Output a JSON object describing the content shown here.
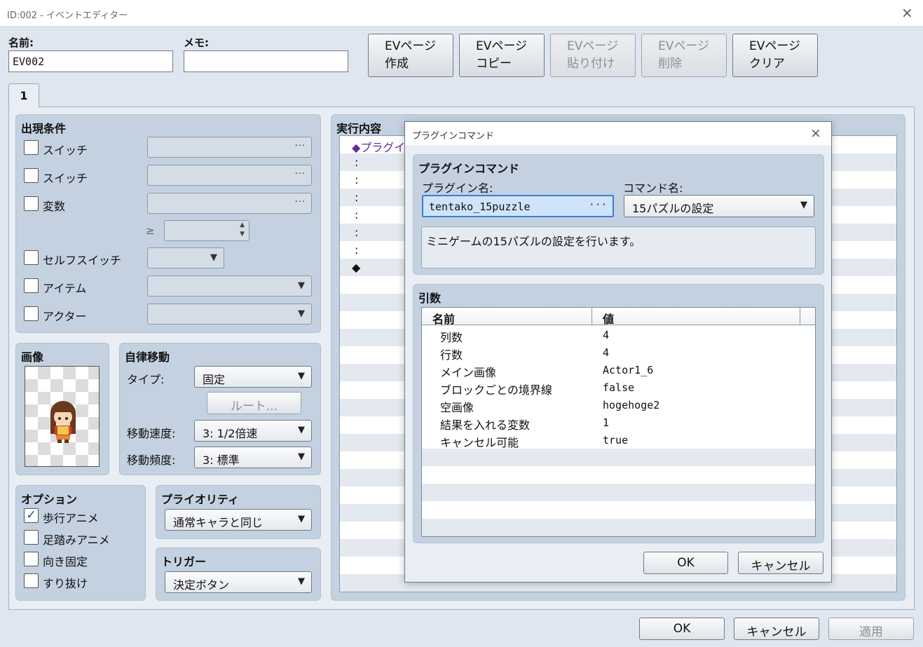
{
  "window": {
    "title": "ID:002 - イベントエディター"
  },
  "header": {
    "name_label": "名前:",
    "name_value": "EV002",
    "memo_label": "メモ:",
    "memo_value": "",
    "ev_buttons": [
      {
        "line1": "EVページ",
        "line2": "作成",
        "enabled": true
      },
      {
        "line1": "EVページ",
        "line2": "コピー",
        "enabled": true
      },
      {
        "line1": "EVページ",
        "line2": "貼り付け",
        "enabled": false
      },
      {
        "line1": "EVページ",
        "line2": "削除",
        "enabled": false
      },
      {
        "line1": "EVページ",
        "line2": "クリア",
        "enabled": true
      }
    ]
  },
  "tabs": [
    "1"
  ],
  "conditions": {
    "title": "出現条件",
    "items": [
      {
        "label": "スイッチ",
        "checked": false
      },
      {
        "label": "スイッチ",
        "checked": false
      },
      {
        "label": "変数",
        "checked": false
      },
      {
        "label": "セルフスイッチ",
        "checked": false
      },
      {
        "label": "アイテム",
        "checked": false
      },
      {
        "label": "アクター",
        "checked": false
      }
    ],
    "gte_symbol": "≥",
    "dots": "…"
  },
  "image_panel": {
    "title": "画像"
  },
  "autonomous": {
    "title": "自律移動",
    "type_label": "タイプ:",
    "type_value": "固定",
    "route_button": "ルート...",
    "speed_label": "移動速度:",
    "speed_value": "3: 1/2倍速",
    "freq_label": "移動頻度:",
    "freq_value": "3: 標準"
  },
  "options": {
    "title": "オプション",
    "items": [
      {
        "label": "歩行アニメ",
        "checked": true
      },
      {
        "label": "足踏みアニメ",
        "checked": false
      },
      {
        "label": "向き固定",
        "checked": false
      },
      {
        "label": "すり抜け",
        "checked": false
      }
    ]
  },
  "priority": {
    "title": "プライオリティ",
    "value": "通常キャラと同じ"
  },
  "trigger": {
    "title": "トリガー",
    "value": "決定ボタン"
  },
  "contents": {
    "title": "実行内容",
    "lines": [
      "◆プラグイ",
      ":",
      ":",
      ":",
      ":",
      ":",
      ":",
      "◆"
    ]
  },
  "dialog": {
    "title": "プラグインコマンド",
    "section_title": "プラグインコマンド",
    "plugin_label": "プラグイン名:",
    "plugin_value": "tentako_15puzzle",
    "command_label": "コマンド名:",
    "command_value": "15パズルの設定",
    "description": "ミニゲームの15パズルの設定を行います。",
    "args_title": "引数",
    "col_name": "名前",
    "col_value": "値",
    "args": [
      {
        "name": "列数",
        "value": "4"
      },
      {
        "name": "行数",
        "value": "4"
      },
      {
        "name": "メイン画像",
        "value": "Actor1_6"
      },
      {
        "name": "ブロックごとの境界線",
        "value": "false"
      },
      {
        "name": "空画像",
        "value": "hogehoge2"
      },
      {
        "name": "結果を入れる変数",
        "value": "1"
      },
      {
        "name": "キャンセル可能",
        "value": "true"
      }
    ],
    "ok": "OK",
    "cancel": "キャンセル"
  },
  "footer": {
    "ok": "OK",
    "cancel": "キャンセル",
    "apply": "適用"
  },
  "icons": {
    "close": "×",
    "dropdown": "▼",
    "dots": "···",
    "check": "✓",
    "spin_up": "▲",
    "spin_down": "▼"
  }
}
